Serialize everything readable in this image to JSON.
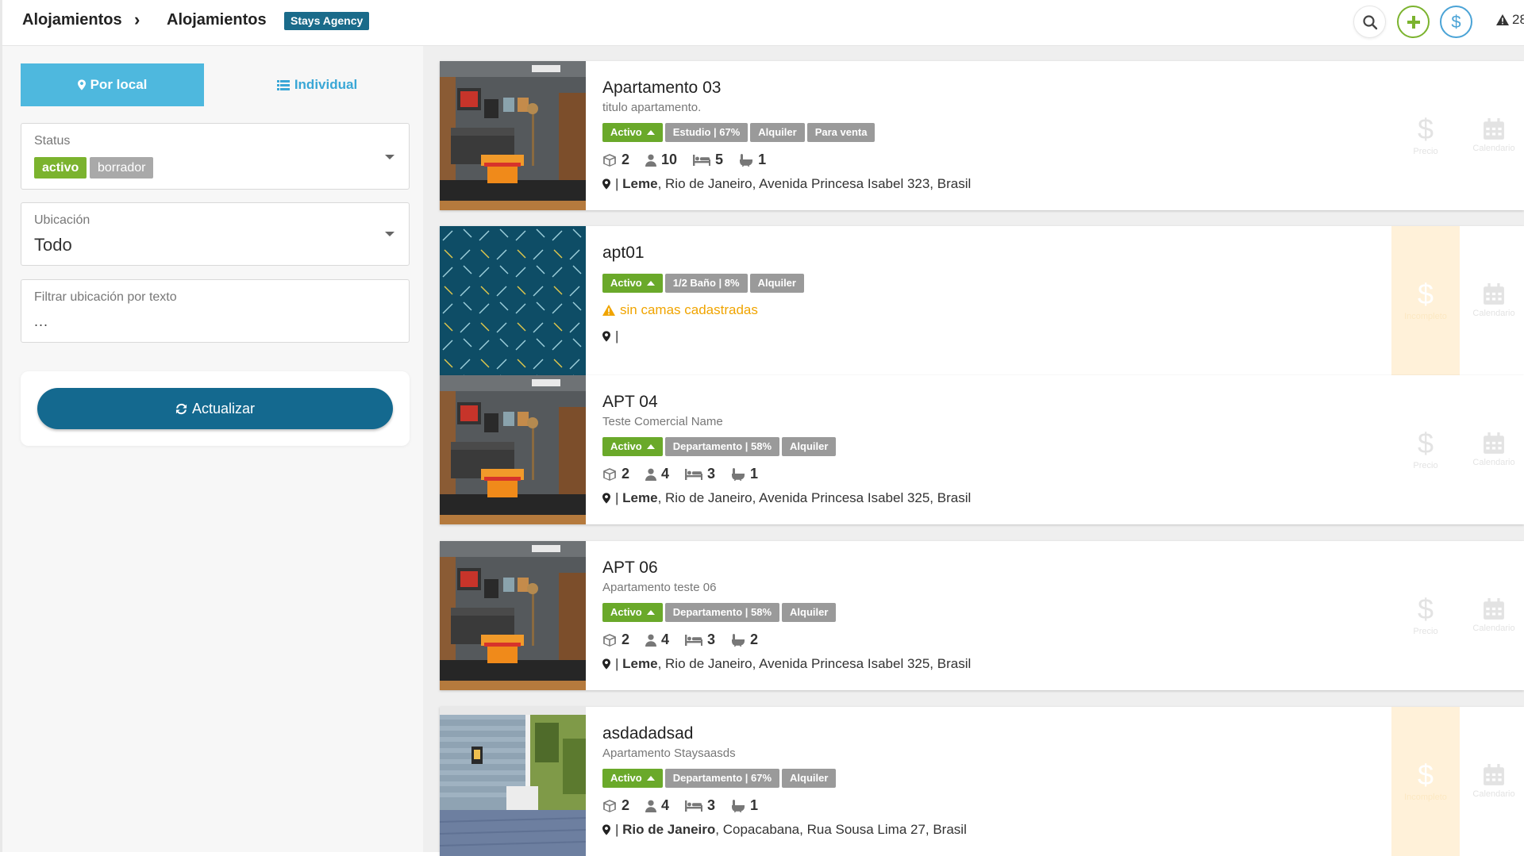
{
  "header": {
    "crumb1": "Alojamientos",
    "crumb_sep": "›",
    "crumb2": "Alojamientos",
    "agency": "Stays Agency",
    "alert_count": "28"
  },
  "sidebar": {
    "toggle_local": "Por local",
    "toggle_individual": "Individual",
    "status_label": "Status",
    "status_tags": [
      "activo",
      "borrador"
    ],
    "location_label": "Ubicación",
    "location_value": "Todo",
    "text_filter_label": "Filtrar ubicación por texto",
    "text_filter_value": "...",
    "refresh_label": "Actualizar"
  },
  "colors": {
    "accent_blue": "#4eb8de",
    "dark_blue": "#14698f",
    "green": "#6aa92a",
    "grey_tag": "#9a9a9a",
    "warning": "#f0a400"
  },
  "side_labels": {
    "price": "Precio",
    "calendar": "Calendario",
    "incomplete": "Incompleto"
  },
  "listings": [
    {
      "title": "Apartamento 03",
      "subtitle": "titulo apartamento.",
      "status": "Activo",
      "badges": [
        "Estudio | 67%",
        "Alquiler",
        "Para venta"
      ],
      "stats": [
        "2",
        "10",
        "5",
        "1"
      ],
      "addr_bold": "Leme",
      "addr_rest": ", Rio de Janeiro, Avenida Princesa Isabel 323, Brasil"
    },
    {
      "title": "apt01",
      "subtitle": "",
      "status": "Activo",
      "badges": [
        "1/2 Baño | 8%",
        "Alquiler"
      ],
      "warning": "sin camas cadastradas",
      "addr_bold": "",
      "addr_rest": ""
    },
    {
      "title": "APT 04",
      "subtitle": "Teste Comercial Name",
      "status": "Activo",
      "badges": [
        "Departamento | 58%",
        "Alquiler"
      ],
      "stats": [
        "2",
        "4",
        "3",
        "1"
      ],
      "addr_bold": "Leme",
      "addr_rest": ", Rio de Janeiro, Avenida Princesa Isabel 325, Brasil"
    },
    {
      "title": "APT 06",
      "subtitle": "Apartamento teste 06",
      "status": "Activo",
      "badges": [
        "Departamento | 58%",
        "Alquiler"
      ],
      "stats": [
        "2",
        "4",
        "3",
        "2"
      ],
      "addr_bold": "Leme",
      "addr_rest": ", Rio de Janeiro, Avenida Princesa Isabel 325, Brasil"
    },
    {
      "title": "asdadadsad",
      "subtitle": "Apartamento Staysaasds",
      "status": "Activo",
      "badges": [
        "Departamento | 67%",
        "Alquiler"
      ],
      "stats": [
        "2",
        "4",
        "3",
        "1"
      ],
      "addr_bold": "Rio de Janeiro",
      "addr_rest": ", Copacabana, Rua Sousa Lima 27, Brasil"
    }
  ]
}
